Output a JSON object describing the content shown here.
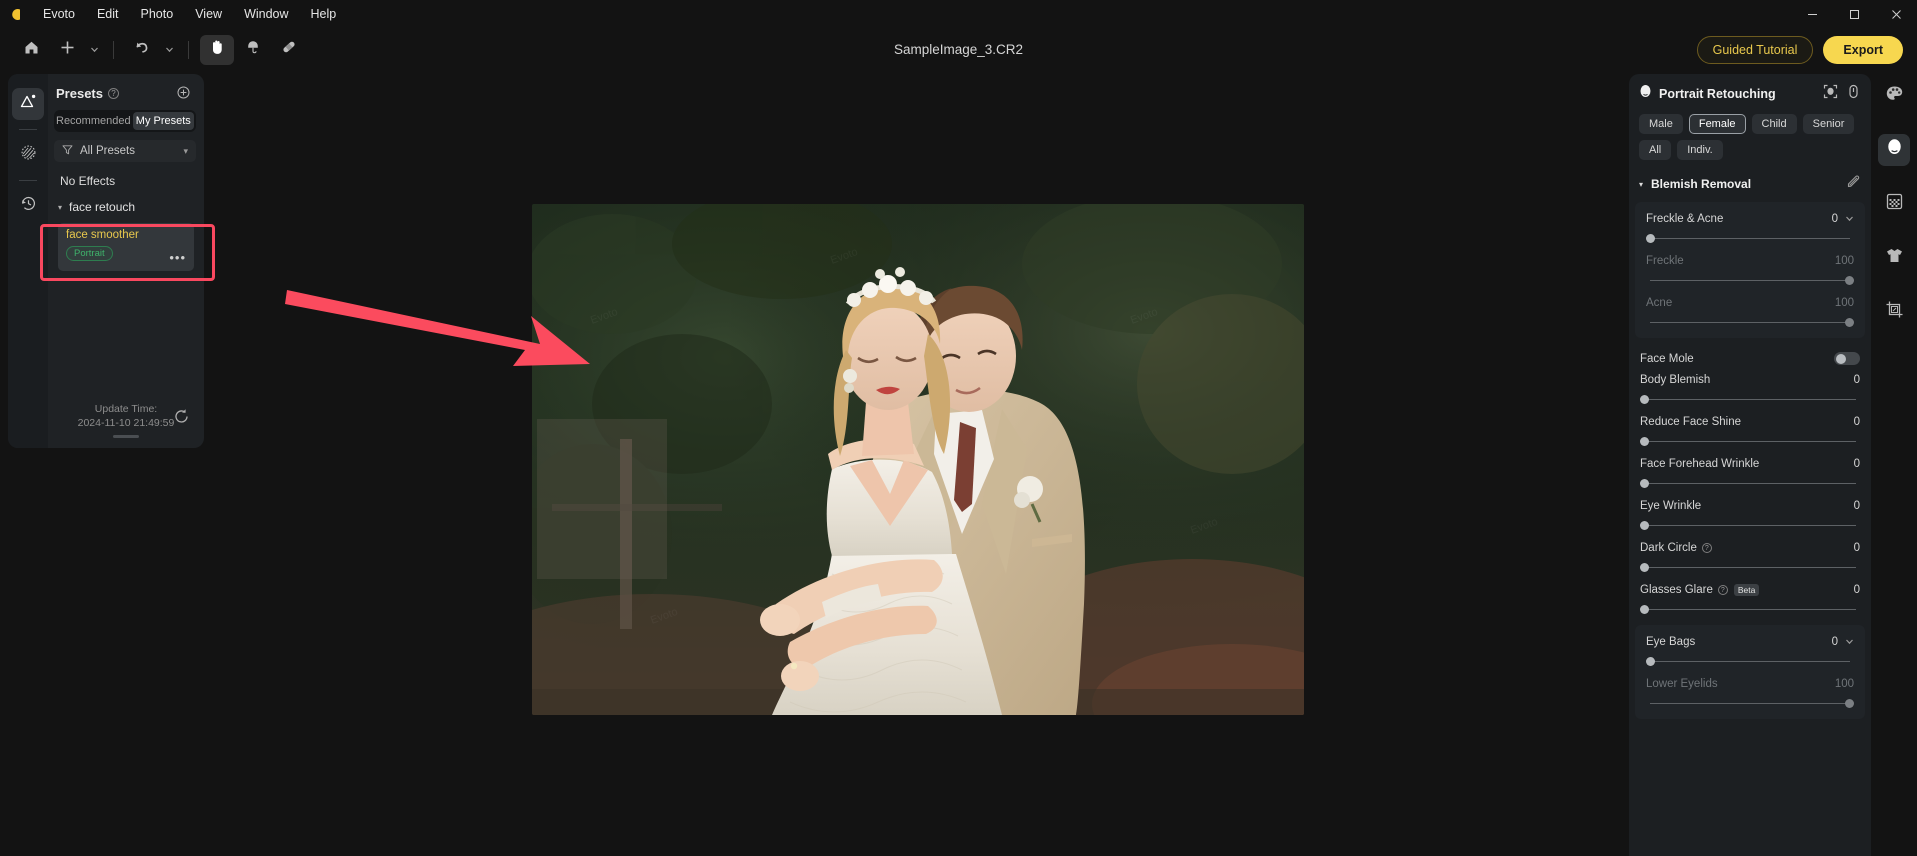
{
  "app": {
    "menu": [
      {
        "label": "Evoto"
      },
      {
        "label": "Edit"
      },
      {
        "label": "Photo"
      },
      {
        "label": "View"
      },
      {
        "label": "Window"
      },
      {
        "label": "Help"
      }
    ],
    "window_controls": {
      "minimize": "—",
      "maximize": "☐",
      "close": "✕"
    }
  },
  "toolbar": {
    "home_icon": "home-icon",
    "add_icon": "plus-icon",
    "undo_icon": "undo-icon",
    "hand_icon": "hand-tool-icon",
    "dodge_icon": "dodge-burn-icon",
    "heal_icon": "healing-brush-icon",
    "document_title": "SampleImage_3.CR2",
    "guided_tutorial_label": "Guided Tutorial",
    "export_label": "Export",
    "tutorial_color": "#e8c84d",
    "export_color": "#f7d74f"
  },
  "left_rail": {
    "items": [
      {
        "name": "presets-icon",
        "active": true
      },
      {
        "name": "texture-icon",
        "active": false
      },
      {
        "name": "history-icon",
        "active": false
      }
    ]
  },
  "presets_panel": {
    "title": "Presets",
    "info_icon": "?",
    "add_icon": "⊕",
    "tabs": [
      {
        "label": "Recommended",
        "active": false
      },
      {
        "label": "My Presets",
        "active": true
      }
    ],
    "filter": {
      "icon": "filter-icon",
      "label": "All Presets",
      "caret": "▾"
    },
    "no_effects_label": "No Effects",
    "group": {
      "caret": "▾",
      "name": "face retouch"
    },
    "preset_card": {
      "name": "face smoother",
      "tag": "Portrait",
      "more": "•••",
      "highlight_color": "#f9485f"
    },
    "update": {
      "label": "Update Time:",
      "value": "2024-11-10 21:49:59",
      "refresh_icon": "refresh-icon"
    }
  },
  "annotation": {
    "arrow_color": "#fb4b5e",
    "name": "pointer-arrow"
  },
  "right_panel": {
    "title": "Portrait Retouching",
    "face_icon": "face-icon",
    "header_icons": [
      {
        "name": "face-detect-icon"
      },
      {
        "name": "compare-icon"
      }
    ],
    "chips": [
      {
        "label": "Male",
        "active": false
      },
      {
        "label": "Female",
        "active": true
      },
      {
        "label": "Child",
        "active": false
      },
      {
        "label": "Senior",
        "active": false
      },
      {
        "label": "All",
        "active": false
      },
      {
        "label": "Indiv.",
        "active": false
      }
    ],
    "section": {
      "caret": "▾",
      "title": "Blemish Removal",
      "edit_icon": "brush-edit-icon"
    },
    "controls": [
      {
        "label": "Freckle & Acne",
        "value": "0",
        "pos": 0,
        "dim": false,
        "caret": true,
        "group": "start"
      },
      {
        "label": "Freckle",
        "value": "100",
        "pos": 100,
        "dim": true,
        "caret": false,
        "group": "mid"
      },
      {
        "label": "Acne",
        "value": "100",
        "pos": 100,
        "dim": true,
        "caret": false,
        "group": "end"
      },
      {
        "label": "Face Mole",
        "value": "",
        "pos": null,
        "dim": false,
        "toggle": true,
        "toggle_on": false
      },
      {
        "label": "Body Blemish",
        "value": "0",
        "pos": 0,
        "dim": false,
        "caret": false
      },
      {
        "label": "Reduce Face Shine",
        "value": "0",
        "pos": 0,
        "dim": false,
        "caret": false
      },
      {
        "label": "Face Forehead Wrinkle",
        "value": "0",
        "pos": 0,
        "dim": false,
        "caret": false
      },
      {
        "label": "Eye Wrinkle",
        "value": "0",
        "pos": 0,
        "dim": false,
        "caret": false
      },
      {
        "label": "Dark Circle",
        "value": "0",
        "pos": 0,
        "dim": false,
        "caret": false,
        "help": true
      },
      {
        "label": "Glasses Glare",
        "value": "0",
        "pos": 0,
        "dim": false,
        "caret": false,
        "help": true,
        "beta": "Beta"
      },
      {
        "label": "Eye Bags",
        "value": "0",
        "pos": 0,
        "dim": false,
        "caret": true,
        "group": "start"
      },
      {
        "label": "Lower Eyelids",
        "value": "100",
        "pos": 100,
        "dim": true,
        "caret": false,
        "group": "end"
      }
    ]
  },
  "right_rail": {
    "items": [
      {
        "name": "palette-icon",
        "active": false
      },
      {
        "name": "portrait-face-icon",
        "active": true
      },
      {
        "name": "texture-grid-icon",
        "active": false
      },
      {
        "name": "clothing-icon",
        "active": false
      },
      {
        "name": "crop-icon",
        "active": false
      }
    ]
  },
  "canvas": {
    "image_name": "wedding-couple-photo"
  }
}
